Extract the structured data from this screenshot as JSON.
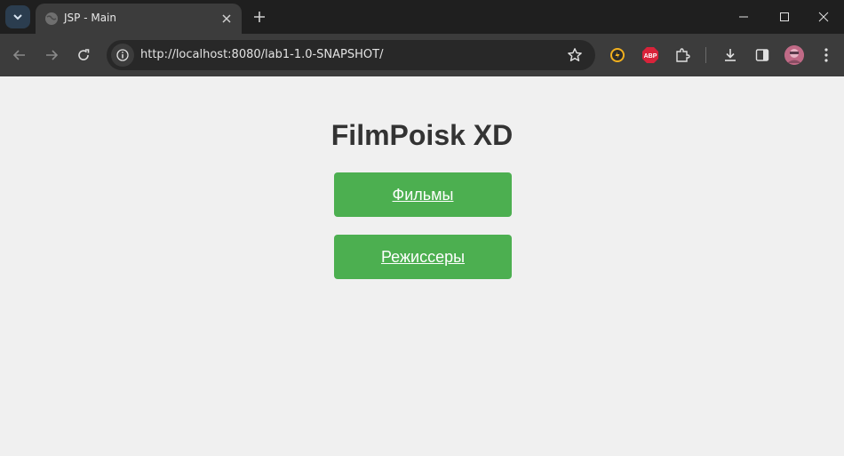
{
  "browser": {
    "tab_title": "JSP - Main",
    "url": "http://localhost:8080/lab1-1.0-SNAPSHOT/",
    "extensions": [
      "yellow-extension-icon",
      "abp-icon",
      "puzzle-icon"
    ],
    "abp_label": "ABP"
  },
  "page": {
    "title": "FilmPoisk XD",
    "links": [
      {
        "label": "Фильмы"
      },
      {
        "label": "Режиссеры"
      }
    ]
  },
  "colors": {
    "accent": "#4caf50",
    "page_bg": "#f0f0f0",
    "title_text": "#333333",
    "chrome_dark": "#1f1f1f",
    "chrome_toolbar": "#3c3c3c"
  }
}
